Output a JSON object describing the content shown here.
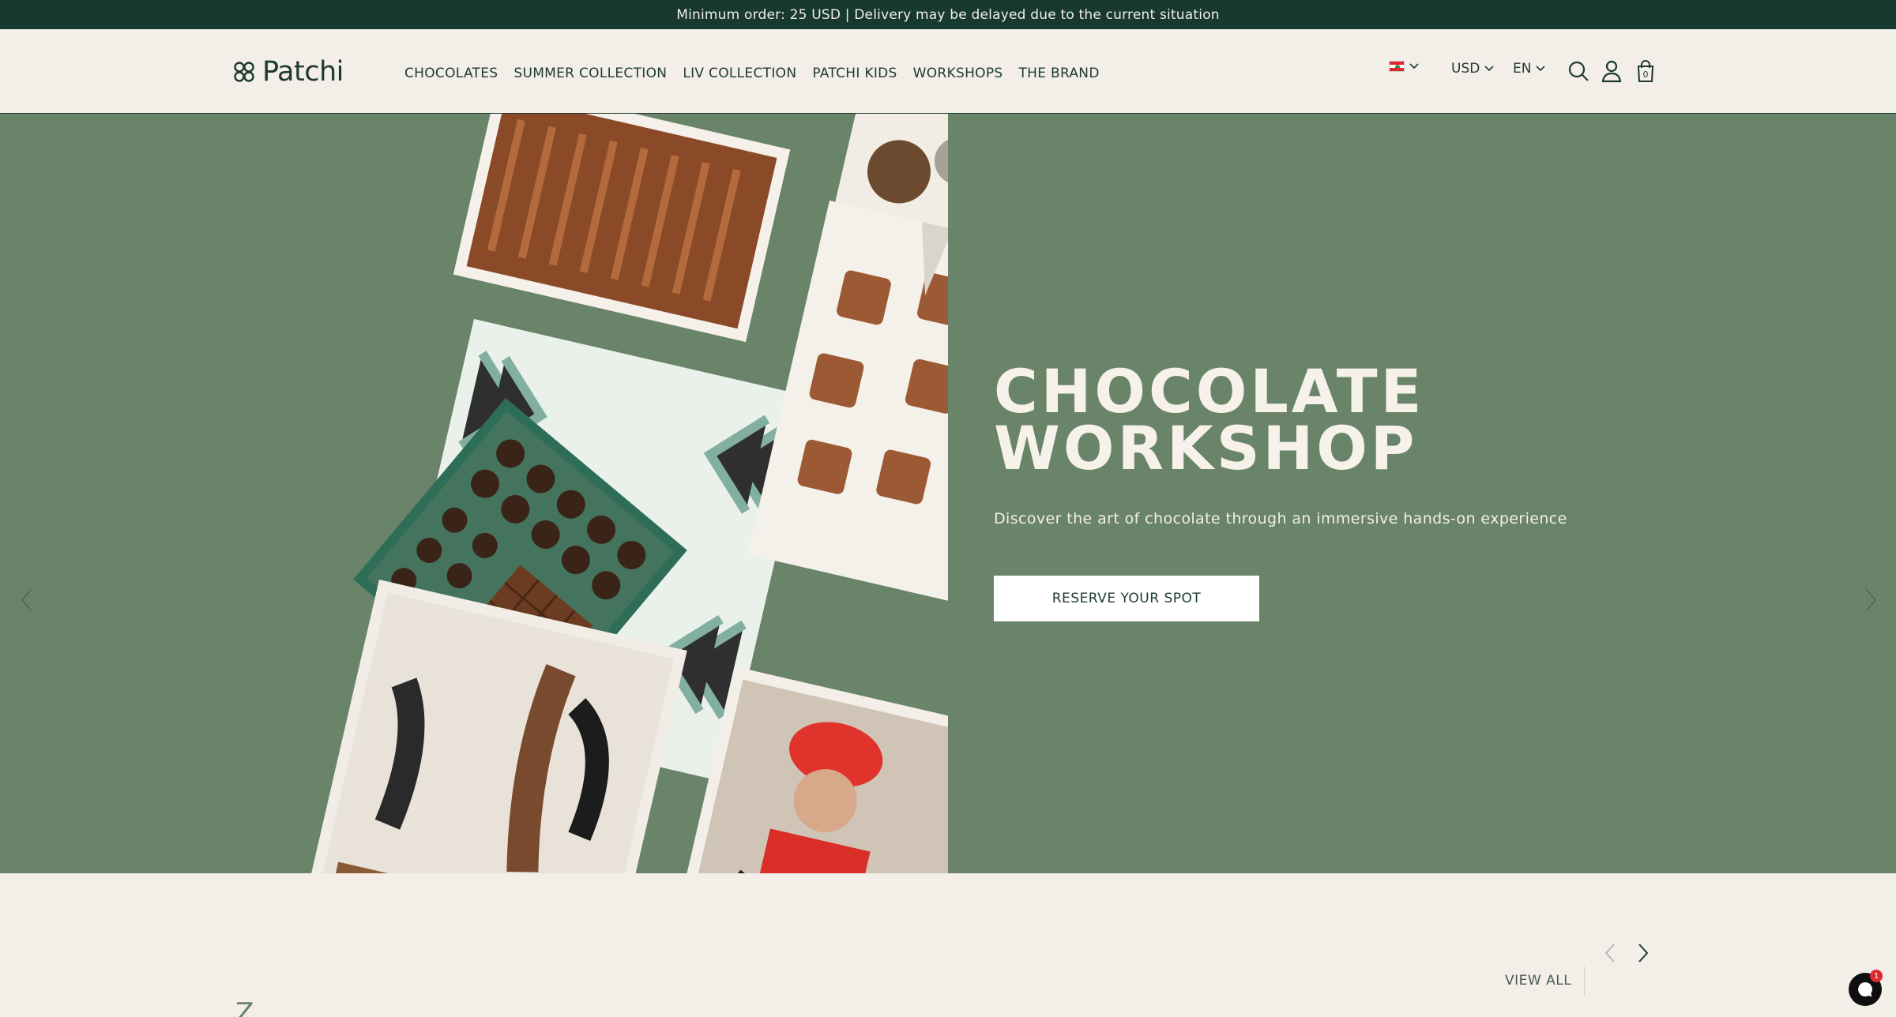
{
  "announcement": "Minimum order: 25 USD | Delivery may be delayed due to the current situation",
  "brand": {
    "name": "Patchi"
  },
  "nav": {
    "items": [
      {
        "label": "CHOCOLATES"
      },
      {
        "label": "SUMMER COLLECTION"
      },
      {
        "label": "LIV COLLECTION"
      },
      {
        "label": "PATCHI KIDS"
      },
      {
        "label": "WORKSHOPS"
      },
      {
        "label": "THE BRAND"
      }
    ]
  },
  "tools": {
    "country_flag": "lebanon-flag-icon",
    "currency": "USD",
    "language": "EN",
    "cart_count": "0"
  },
  "hero": {
    "title_line1": "CHOCOLATE",
    "title_line2": "WORKSHOP",
    "subtitle": "Discover the art of chocolate through an immersive hands-on experience",
    "cta": "RESERVE YOUR SPOT",
    "background_color": "#6a8469"
  },
  "section": {
    "view_all": "VIEW ALL",
    "partial_title_glimpse": "Z"
  },
  "chat": {
    "badge_count": "1"
  },
  "colors": {
    "announcement_bg": "#17392f",
    "page_bg": "#f3eee8",
    "brand_green": "#1e3a2f",
    "hero_green": "#6a8469"
  }
}
